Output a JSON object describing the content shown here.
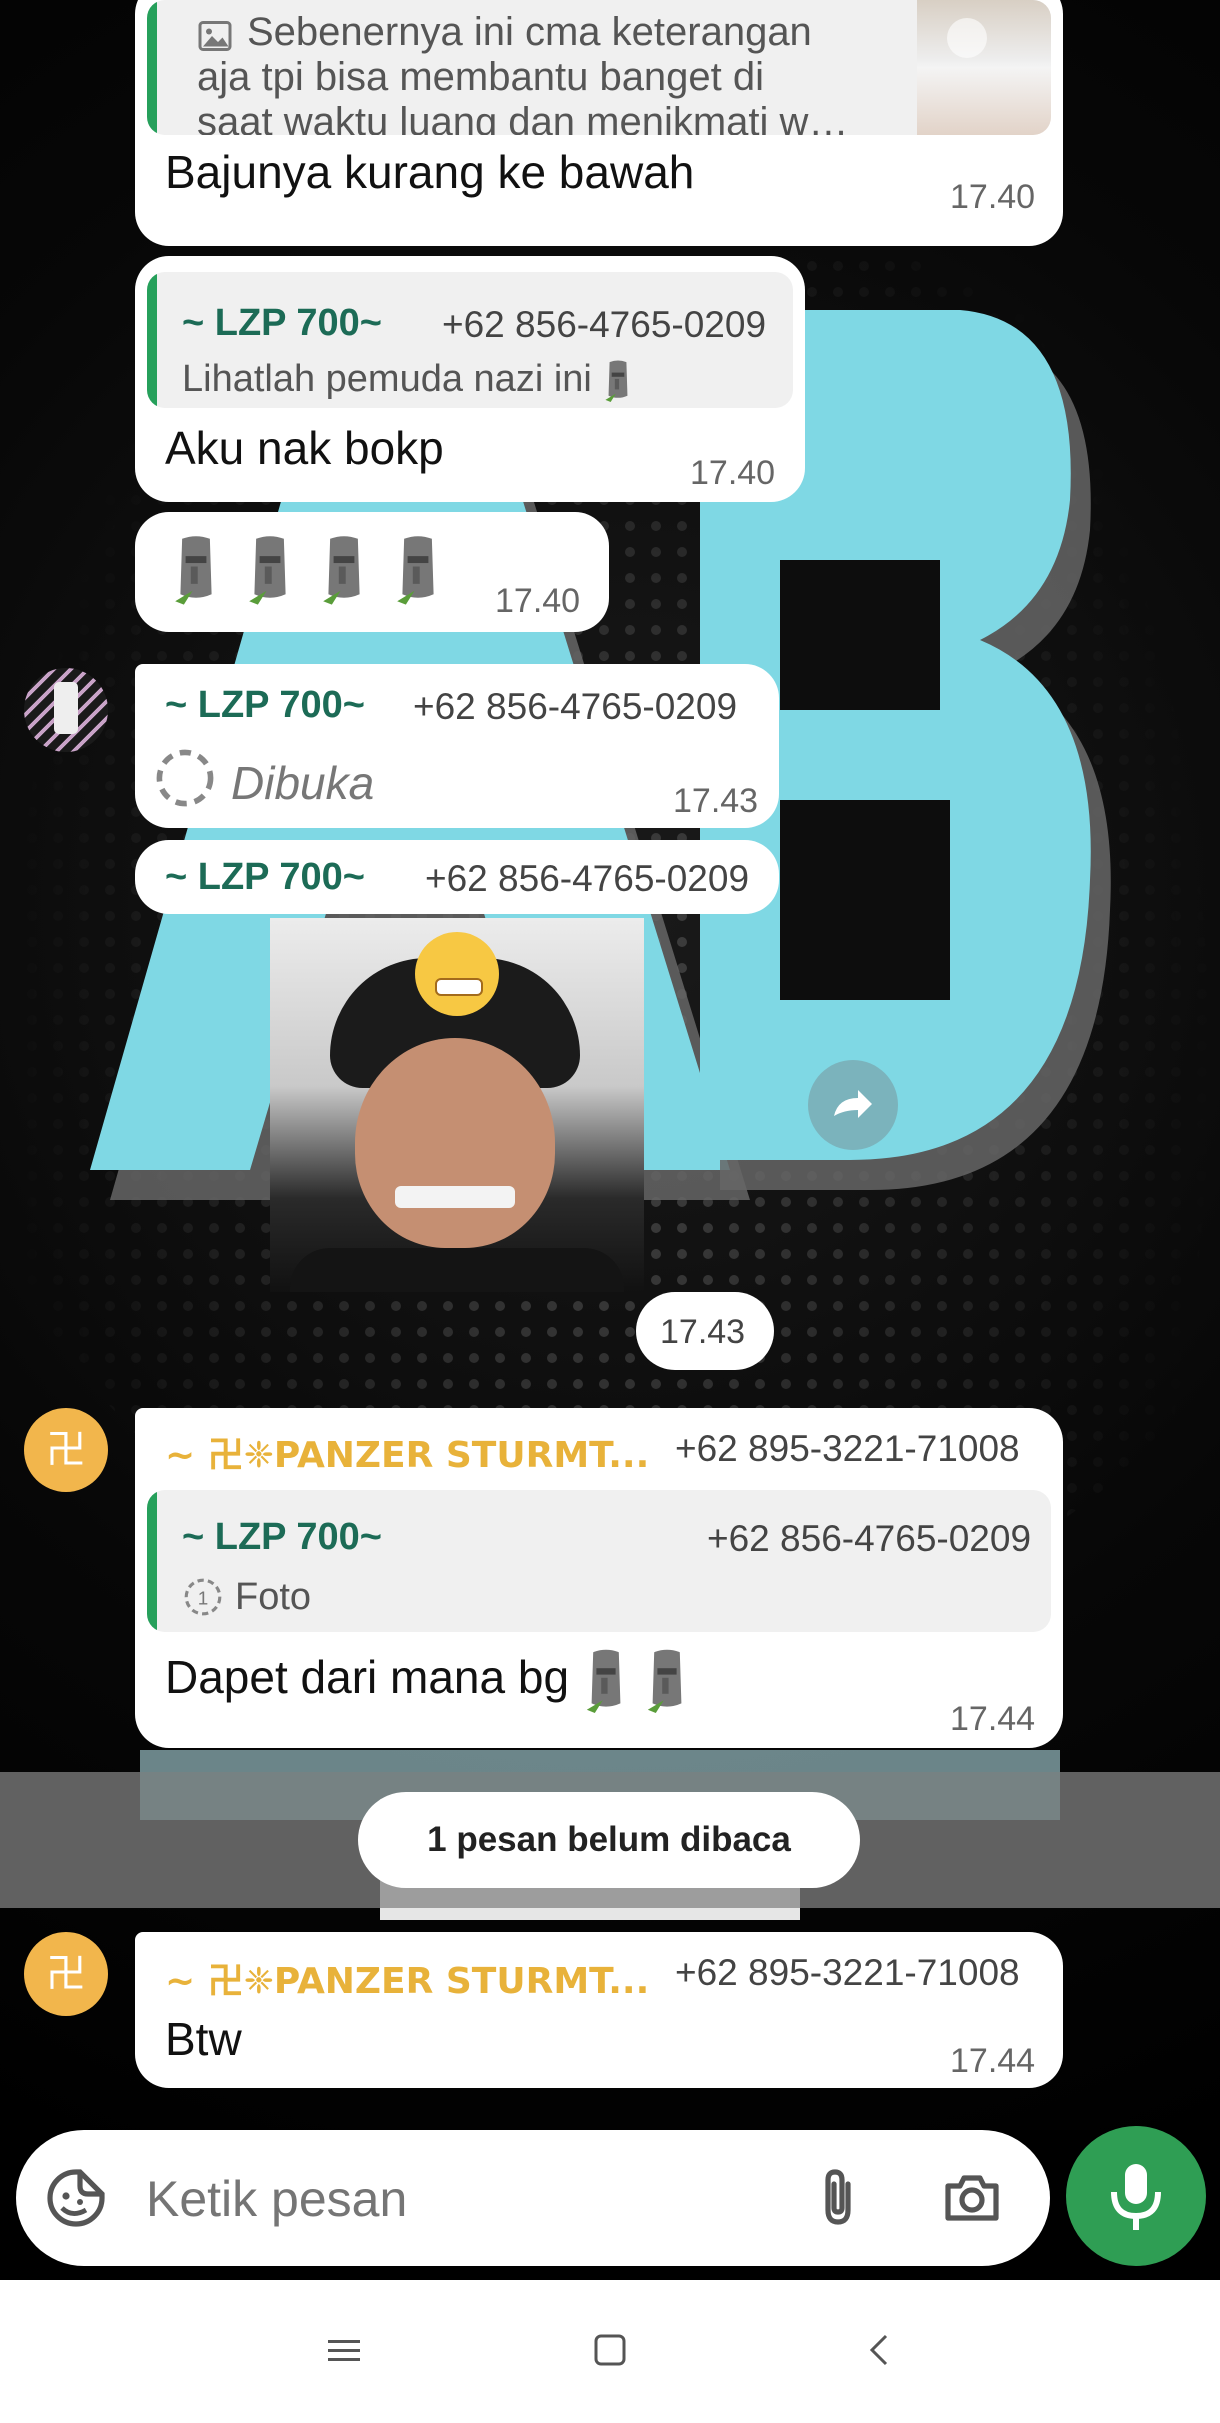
{
  "messages": {
    "m1": {
      "link_preview_text": "Sebenernya ini cma keterangan aja tpi bisa membantu banget di saat waktu luang dan menikmati w…",
      "link_preview_line1": "Sebenernya ini cma keterangan",
      "link_preview_line2": "aja tpi bisa membantu banget di",
      "link_preview_line3": "saat waktu luang dan menikmati w…",
      "text": "Bajunya kurang ke bawah",
      "time": "17.40"
    },
    "m2": {
      "quote_name": "~ LZP 700~",
      "quote_phone": "+62 856-4765-0209",
      "quote_text": "Lihatlah pemuda nazi ini",
      "text": "Aku nak bokp",
      "time": "17.40"
    },
    "m3": {
      "emoji_count": 4,
      "time": "17.40"
    },
    "m4": {
      "sender_name": "~ LZP 700~",
      "sender_phone": "+62 856-4765-0209",
      "status_text": "Dibuka",
      "time": "17.43"
    },
    "m5": {
      "sender_name": "~ LZP 700~",
      "sender_phone": "+62 856-4765-0209",
      "time": "17.43"
    },
    "m6": {
      "sender_name": "~ 卍❈PANZER STURMT...",
      "sender_phone": "+62 895-3221-71008",
      "avatar_glyph": "卍",
      "quote_name": "~ LZP 700~",
      "quote_phone": "+62 856-4765-0209",
      "quote_badge": "1",
      "quote_text": "Foto",
      "text": "Dapet dari mana bg",
      "time": "17.44"
    },
    "unread_banner": "1 pesan belum dibaca",
    "m7": {
      "sender_name": "~ 卍❈PANZER STURMT...",
      "sender_phone": "+62 895-3221-71008",
      "avatar_glyph": "卍",
      "text": "Btw",
      "time": "17.44"
    }
  },
  "composer": {
    "placeholder": "Ketik pesan"
  },
  "colors": {
    "accent_green": "#26a05b",
    "quote_name": "#1c6b56",
    "panzer_name": "#e8b23a",
    "wallpaper_cyan": "#7fd8e4",
    "mic_button": "#2f9e54"
  },
  "icons": [
    "image-icon",
    "forward-icon",
    "sticker-icon",
    "attach-icon",
    "camera-icon",
    "mic-icon",
    "nav-menu-icon",
    "nav-home-icon",
    "nav-back-icon"
  ]
}
